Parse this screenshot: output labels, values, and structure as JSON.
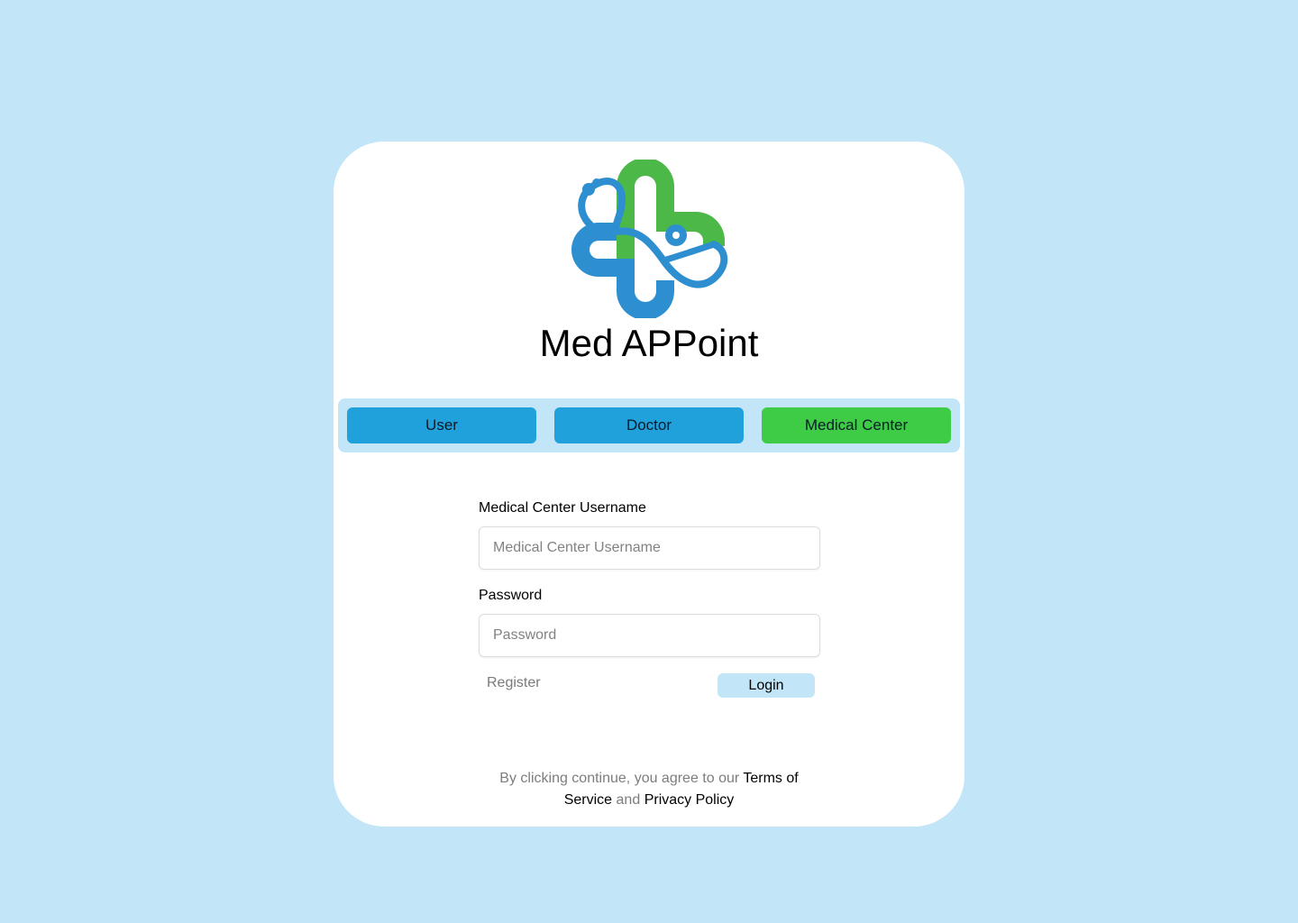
{
  "app": {
    "title": "Med APPoint",
    "logo_icon": "medical-cross-stethoscope-icon"
  },
  "roles": {
    "items": [
      {
        "label": "User",
        "color": "#21a1db"
      },
      {
        "label": "Doctor",
        "color": "#21a1db"
      },
      {
        "label": "Medical Center",
        "color": "#3ecc46"
      }
    ],
    "selected": "Medical Center"
  },
  "form": {
    "username_label": "Medical Center Username",
    "username_placeholder": "Medical Center Username",
    "username_value": "",
    "password_label": "Password",
    "password_placeholder": "Password",
    "password_value": "",
    "register_label": "Register",
    "login_label": "Login"
  },
  "legal": {
    "prefix": "By clicking continue, you agree to our",
    "terms": "Terms of Service",
    "connector": "and",
    "privacy": "Privacy Policy"
  },
  "colors": {
    "background": "#c2e6f7",
    "card": "#ffffff",
    "brand_blue": "#2d8fd0",
    "brand_green": "#4bb848"
  }
}
